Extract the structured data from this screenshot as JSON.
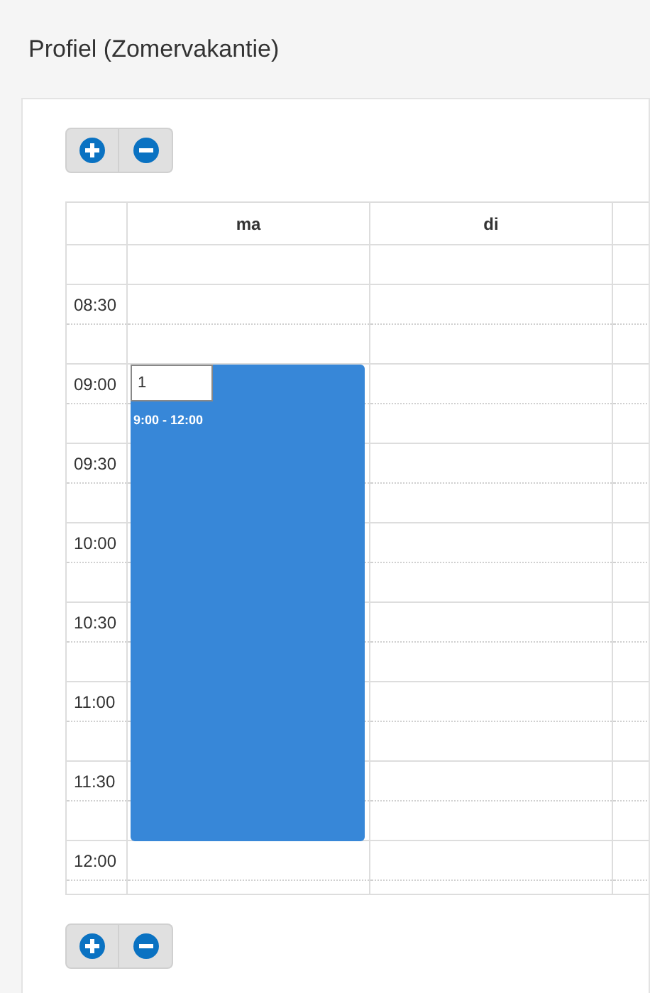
{
  "title": "Profiel (Zomervakantie)",
  "top_buttons": [
    {
      "kind": "zoom-in"
    },
    {
      "kind": "zoom-out"
    }
  ],
  "days": [
    {
      "label": "ma",
      "events": [
        {
          "value": "1",
          "time": "9:00 - 12:00"
        }
      ]
    },
    {
      "label": "di"
    }
  ],
  "times": [
    "08:30",
    "09:00",
    "09:30",
    "10:00",
    "10:30",
    "11:00",
    "11:30",
    "12:00"
  ],
  "bottom_buttons": [
    {
      "kind": "zoom-in"
    },
    {
      "kind": "zoom-out"
    }
  ]
}
